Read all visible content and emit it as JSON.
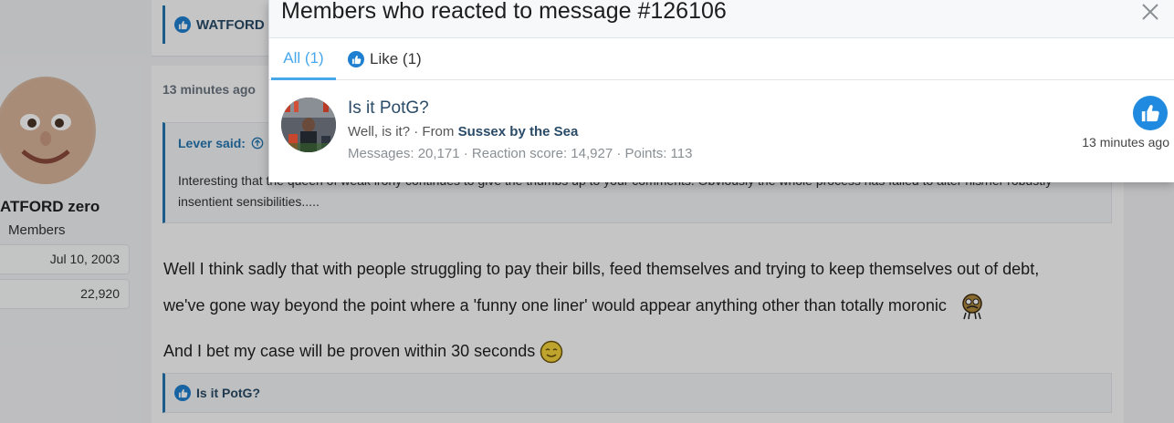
{
  "background": {
    "prev_post": {
      "reaction_label": "WATFORD"
    },
    "user": {
      "name": "ATFORD zero",
      "title": "Members",
      "joined": "Jul 10, 2003",
      "messages": "22,920"
    },
    "post": {
      "time": "13 minutes ago",
      "quote_author": "Lever said:",
      "quote_text": "Interesting that the queen of weak irony continues to give the thumbs up to your comments. Obviously the whole process has failed to alter his/her robustly insentient sensibilities.....",
      "line1": "Well I think sadly that with people struggling to pay their bills, feed themselves and trying to keep themselves out of debt,",
      "line2": "we've gone way beyond the point where a 'funny one liner' would appear anything other than totally moronic",
      "line3": "And I bet my case will be proven within 30 seconds",
      "reaction_label": "Is it PotG?"
    }
  },
  "modal": {
    "title": "Members who reacted to message #126106",
    "tabs": [
      {
        "label": "All (1)"
      },
      {
        "label": "Like (1)"
      }
    ],
    "member": {
      "name": "Is it PotG?",
      "subtitle_prefix": "Well, is it? · From",
      "location": "Sussex by the Sea",
      "stats": "Messages: 20,171 · Reaction score: 14,927 · Points: 113",
      "time": "13 minutes ago"
    }
  },
  "colors": {
    "accent": "#47a7eb",
    "link": "#2a4b67",
    "like": "#1f8ae0"
  }
}
